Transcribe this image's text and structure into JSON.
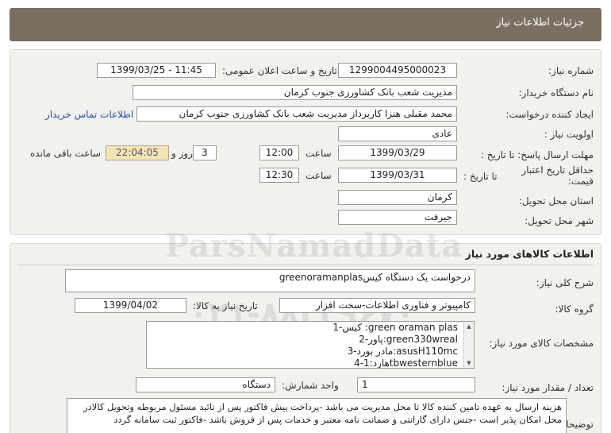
{
  "header": {
    "title": "جزئیات اطلاعات نیاز"
  },
  "details": {
    "need_number_label": "شماره نیاز:",
    "need_number": "1299004495000023",
    "announce_label": "تاریخ و ساعت اعلان عمومی:",
    "announce_value": "1399/03/25 - 11:45",
    "buyer_org_label": "نام دستگاه خریدار:",
    "buyer_org": "مدیریت شعب بانک کشاورزی جنوب کرمان",
    "requester_label": "ایجاد کننده درخواست:",
    "requester": "محمد مقبلی هنزا کاربرداز مدیریت شعب بانک کشاورزی جنوب کرمان",
    "contact_link": "اطلاعات تماس خریدار",
    "priority_label": "اولویت نیاز :",
    "priority": "عادی",
    "deadline_label": "مهلت ارسال پاسخ: تا تاریخ :",
    "deadline_date": "1399/03/29",
    "time_label": "ساعت",
    "deadline_time": "12:00",
    "days": "3",
    "days_label": "روز و",
    "remaining": "22:04:05",
    "remaining_label": "ساعت باقی مانده",
    "validity_label_1": "حداقل تاریخ اعتبار",
    "validity_label_2": "قیمت:",
    "validity_to_label": "تا تاریخ :",
    "validity_date": "1399/03/31",
    "validity_time": "12:30",
    "province_label": "استان محل تحویل:",
    "province": "کرمان",
    "city_label": "شهر محل تحویل:",
    "city": "جیرفت"
  },
  "goods": {
    "section_title": "اطلاعات کالاهای مورد نیاز",
    "summary_label": "شرح کلی نیاز:",
    "summary": "درخواست یک دستگاه کیسgreenoramanplas",
    "group_label": "گروه کالا:",
    "group": "کامپیوتر و فناوری اطلاعات-سخت افزار",
    "need_date_label": "تاریخ نیاز به کالا:",
    "need_date": "1399/04/02",
    "specs_label": "مشخصات کالای مورد نیاز:",
    "specs": [
      "1-کیس :green oraman plas",
      "2-پاور:green330wreal",
      "3-مادر بورد:asusH110mc",
      "4-هارد:1tbwesternblue"
    ],
    "quantity_label": "تعداد / مقدار مورد نیاز:",
    "quantity": "1",
    "unit_label": "واحد شمارش:",
    "unit": "دستگاه",
    "notes_label": "توضیحات خریدار:",
    "notes": "هزینه ارسال به عهده تامین کننده کالا تا محل مدیریت می باشد -پرداخت پیش فاکتور پس از تائید مسئول مربوطه وتحویل کالادر محل امکان پذیر است -جنس دارای گارانتی و ضمانت نامه معتبر و خدمات پس از فروش باشد -فاکتور ثبت سامانه گردد"
  },
  "watermark": {
    "text": "ParsNamadData",
    "phone": "۰۲۱-۸۸۳۴۹۶۷۰"
  }
}
